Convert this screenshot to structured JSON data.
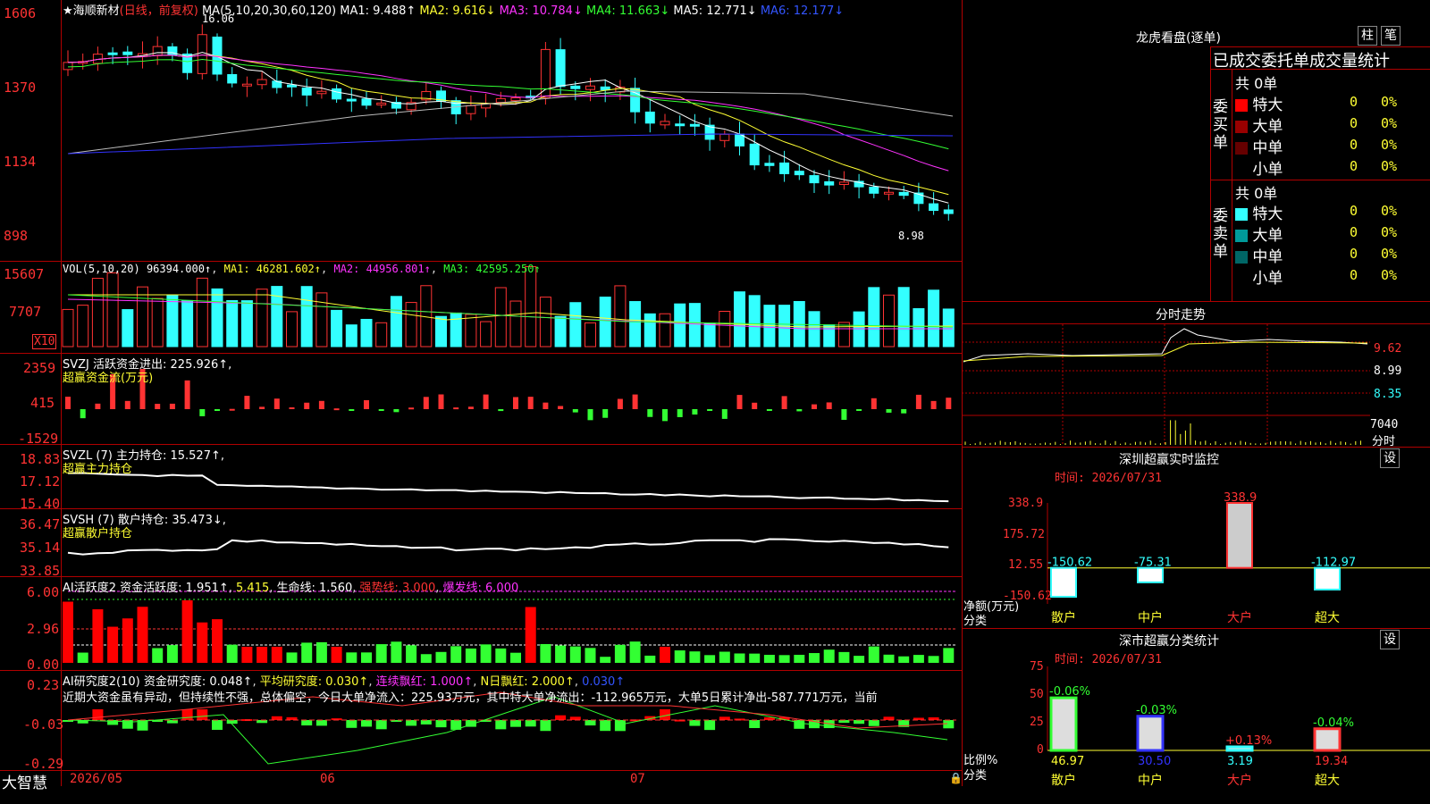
{
  "header": {
    "stock_name": "★海顺新材",
    "period": "(日线，前复权)",
    "ma_label": "MA(5,10,20,30,60,120)",
    "ma1": "MA1: 9.488↑",
    "ma2": "MA2: 9.616↓",
    "ma3": "MA3: 10.784↓",
    "ma4": "MA4: 11.663↓",
    "ma5": "MA5: 12.771↓",
    "ma6": "MA6: 12.177↓",
    "high_mark": "16.06",
    "low_mark": "8.98"
  },
  "price_axis": [
    "1606",
    "1370",
    "1134",
    "898"
  ],
  "vol": {
    "label": "VOL(5,10,20)",
    "value": "96394.000↑",
    "ma1": "MA1: 46281.602↑",
    "ma2": "MA2: 44956.801↑",
    "ma3": "MA3: 42595.250↑",
    "axis": [
      "15607",
      "7707"
    ],
    "unit": "X10"
  },
  "svzj": {
    "label": "SVZJ  活跃资金进出: 225.926↑,",
    "sub": "超赢资金流(万元)",
    "axis": [
      "2359",
      "415",
      "-1529"
    ]
  },
  "svzl": {
    "label": "SVZL (7) 主力持仓: 15.527↑,",
    "sub": "超赢主力持仓",
    "axis": [
      "18.83",
      "17.12",
      "15.40"
    ]
  },
  "svsh": {
    "label": "SVSH (7) 散户持仓: 35.473↓,",
    "sub": "超赢散户持仓",
    "axis": [
      "36.47",
      "35.14",
      "33.85"
    ]
  },
  "ai_active": {
    "label": "AI活跃度2 资金活跃度: 1.951↑",
    "v2": "5.415",
    "life": "生命线: 1.560",
    "strong": "强势线: 3.000",
    "burst": "爆发线: 6.000",
    "axis": [
      "6.00",
      "2.96",
      "0.00"
    ]
  },
  "ai_research": {
    "label": "AI研究度2(10) 资金研究度: 0.048↑",
    "avg": "平均研究度: 0.030↑",
    "cont": "连续飘红: 1.000↑",
    "n": "N日飘红: 2.000↑",
    "last": "0.030↑",
    "axis": [
      "0.23",
      "-0.03",
      "-0.29"
    ],
    "comment": "近期大资金虽有异动，但持续性不强，总体偏空，今日大单净流入：225.93万元，其中特大单净流出：-112.965万元，大单5日累计净出-587.771万元，当前"
  },
  "date_axis": [
    "2026/05",
    "06",
    "07"
  ],
  "brand": "大智慧",
  "right": {
    "longhu_title": "龙虎看盘(逐单)",
    "btn_zhu": "柱",
    "btn_bi": "笔",
    "stats_title": "已成交委托单成交量统计",
    "buy_label": "委买单",
    "sell_label": "委卖单",
    "buy_total": "共 0单",
    "sell_total": "共 0单",
    "buy_rows": [
      {
        "name": "特大",
        "count": "0",
        "pct": "0%",
        "color": "#ff0000"
      },
      {
        "name": "大单",
        "count": "0",
        "pct": "0%",
        "color": "#990000"
      },
      {
        "name": "中单",
        "count": "0",
        "pct": "0%",
        "color": "#660000"
      },
      {
        "name": "小单",
        "count": "0",
        "pct": "0%",
        "color": "#000000"
      }
    ],
    "sell_rows": [
      {
        "name": "特大",
        "count": "0",
        "pct": "0%",
        "color": "#33ffff"
      },
      {
        "name": "大单",
        "count": "0",
        "pct": "0%",
        "color": "#009999"
      },
      {
        "name": "中单",
        "count": "0",
        "pct": "0%",
        "color": "#006666"
      },
      {
        "name": "小单",
        "count": "0",
        "pct": "0%",
        "color": "#000000"
      }
    ],
    "fenshi_title": "分时走势",
    "fenshi_axis": [
      "9.62",
      "8.99",
      "8.35",
      "7040"
    ],
    "fenshi_unit": "分时",
    "monitor_title": "深圳超赢实时监控",
    "monitor_time": "时间: 2026/07/31",
    "monitor_btn": "设",
    "monitor_axis": [
      "338.9",
      "175.72",
      "12.55",
      "-150.62"
    ],
    "monitor_ylabel": "净额(万元)",
    "monitor_xlabel": "分类",
    "class_title": "深市超赢分类统计",
    "class_time": "时间: 2026/07/31",
    "class_btn": "设",
    "class_axis": [
      "75",
      "50",
      "25",
      "0"
    ],
    "class_ylabel": "比例%",
    "class_xlabel": "分类"
  },
  "chart_data": [
    {
      "type": "bar",
      "title": "深圳超赢实时监控",
      "categories": [
        "散户",
        "中户",
        "大户",
        "超大"
      ],
      "values": [
        -150.62,
        -75.31,
        338.9,
        -112.97
      ],
      "ylabel": "净额(万元)",
      "xlabel": "分类",
      "ylim": [
        -150.62,
        338.9
      ]
    },
    {
      "type": "bar",
      "title": "深市超赢分类统计",
      "categories": [
        "散户",
        "中户",
        "大户",
        "超大"
      ],
      "values": [
        46.97,
        30.5,
        3.19,
        19.34
      ],
      "changes": [
        "-0.06%",
        "-0.03%",
        "+0.13%",
        "-0.04%"
      ],
      "ylabel": "比例%",
      "xlabel": "分类",
      "ylim": [
        0,
        75
      ]
    }
  ]
}
